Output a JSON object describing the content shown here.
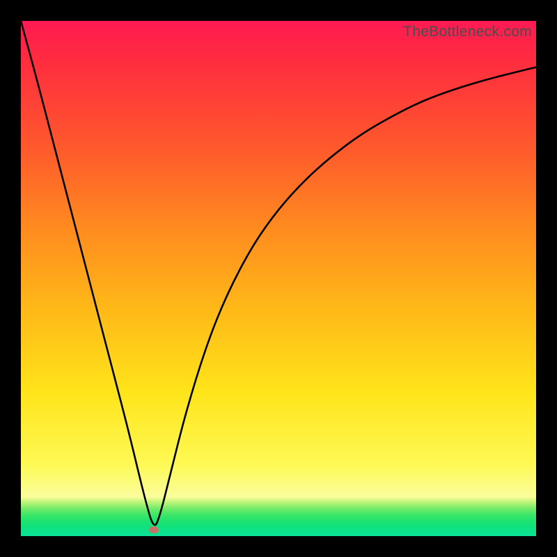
{
  "watermark": "TheBottleneck.com",
  "colors": {
    "top": "#ff1a52",
    "mid": "#ffe41a",
    "bottom": "#0ce296",
    "curve": "#000000",
    "dot": "#c77168",
    "frame": "#000000"
  },
  "chart_data": {
    "type": "line",
    "title": "",
    "xlabel": "",
    "ylabel": "",
    "xlim": [
      0,
      100
    ],
    "ylim": [
      0,
      100
    ],
    "grid": false,
    "legend": false,
    "annotations": [
      {
        "text": "TheBottleneck.com",
        "pos": "top-right"
      }
    ],
    "marker": {
      "x": 25.8,
      "y": 1.2,
      "color": "#c77168",
      "shape": "ellipse"
    },
    "series": [
      {
        "name": "bottleneck-curve",
        "color": "#000000",
        "x": [
          0,
          3,
          6,
          9,
          12,
          15,
          18,
          21,
          24,
          25.8,
          27,
          29,
          32,
          36,
          40,
          45,
          50,
          55,
          60,
          66,
          72,
          78,
          84,
          90,
          95,
          100
        ],
        "values": [
          100,
          89,
          77.5,
          66,
          54.5,
          43,
          31.5,
          20,
          7.5,
          1.2,
          4,
          12,
          24,
          37,
          47,
          56.5,
          63.5,
          69,
          73.5,
          78,
          81.5,
          84.5,
          86.7,
          88.5,
          89.8,
          91
        ]
      }
    ]
  }
}
